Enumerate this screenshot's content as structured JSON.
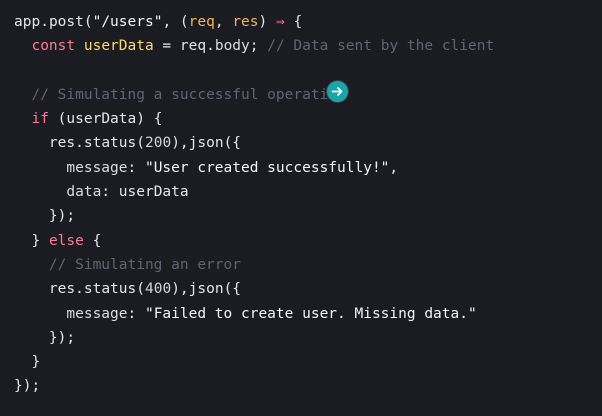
{
  "code": {
    "lines": [
      {
        "t": [
          [
            "fn",
            "app"
          ],
          [
            "punc",
            "."
          ],
          [
            "fn",
            "post"
          ],
          [
            "punc",
            "("
          ],
          [
            "str",
            "\"/users\""
          ],
          [
            "punc",
            ", ("
          ],
          [
            "param",
            "req"
          ],
          [
            "punc",
            ", "
          ],
          [
            "param",
            "res"
          ],
          [
            "punc",
            ") "
          ],
          [
            "arrow",
            "⇒"
          ],
          [
            "punc",
            " {"
          ]
        ]
      },
      {
        "t": [
          [
            "punc",
            "  "
          ],
          [
            "kw",
            "const "
          ],
          [
            "var",
            "userData"
          ],
          [
            "punc",
            " = "
          ],
          [
            "fn",
            "req"
          ],
          [
            "punc",
            "."
          ],
          [
            "prop",
            "body"
          ],
          [
            "punc",
            "; "
          ],
          [
            "cm",
            "// Data sent by the client"
          ]
        ]
      },
      {
        "t": []
      },
      {
        "t": [
          [
            "punc",
            "  "
          ],
          [
            "cm",
            "// Simulating a successful operation"
          ]
        ]
      },
      {
        "t": [
          [
            "punc",
            "  "
          ],
          [
            "kw",
            "if"
          ],
          [
            "punc",
            " ("
          ],
          [
            "fn",
            "userData"
          ],
          [
            "punc",
            ") {"
          ]
        ]
      },
      {
        "t": [
          [
            "punc",
            "    "
          ],
          [
            "fn",
            "res"
          ],
          [
            "punc",
            "."
          ],
          [
            "fn",
            "status"
          ],
          [
            "punc",
            "("
          ],
          [
            "num",
            "200"
          ],
          [
            "punc",
            "),"
          ],
          [
            "fn",
            "json"
          ],
          [
            "punc",
            "({"
          ]
        ]
      },
      {
        "t": [
          [
            "punc",
            "      "
          ],
          [
            "prop",
            "message"
          ],
          [
            "punc",
            ": "
          ],
          [
            "str",
            "\"User created successfully!\""
          ],
          [
            "punc",
            ","
          ]
        ]
      },
      {
        "t": [
          [
            "punc",
            "      "
          ],
          [
            "prop",
            "data"
          ],
          [
            "punc",
            ": "
          ],
          [
            "fn",
            "userData"
          ]
        ]
      },
      {
        "t": [
          [
            "punc",
            "    "
          ],
          [
            "punc",
            "});"
          ]
        ]
      },
      {
        "t": [
          [
            "punc",
            "  "
          ],
          [
            "punc",
            "} "
          ],
          [
            "kw",
            "else"
          ],
          [
            "punc",
            " {"
          ]
        ]
      },
      {
        "t": [
          [
            "punc",
            "    "
          ],
          [
            "cm",
            "// Simulating an error"
          ]
        ]
      },
      {
        "t": [
          [
            "punc",
            "    "
          ],
          [
            "fn",
            "res"
          ],
          [
            "punc",
            "."
          ],
          [
            "fn",
            "status"
          ],
          [
            "punc",
            "("
          ],
          [
            "num",
            "400"
          ],
          [
            "punc",
            "),"
          ],
          [
            "fn",
            "json"
          ],
          [
            "punc",
            "({"
          ]
        ]
      },
      {
        "t": [
          [
            "punc",
            "      "
          ],
          [
            "prop",
            "message"
          ],
          [
            "punc",
            ": "
          ],
          [
            "str",
            "\"Failed to create user. Missing data.\""
          ]
        ]
      },
      {
        "t": [
          [
            "punc",
            "    "
          ],
          [
            "punc",
            "});"
          ]
        ]
      },
      {
        "t": [
          [
            "punc",
            "  "
          ],
          [
            "punc",
            "}"
          ]
        ]
      },
      {
        "t": [
          [
            "punc",
            "});"
          ]
        ]
      }
    ]
  },
  "cursor": {
    "icon": "arrow-right-icon",
    "color": "#1aa3a8"
  }
}
